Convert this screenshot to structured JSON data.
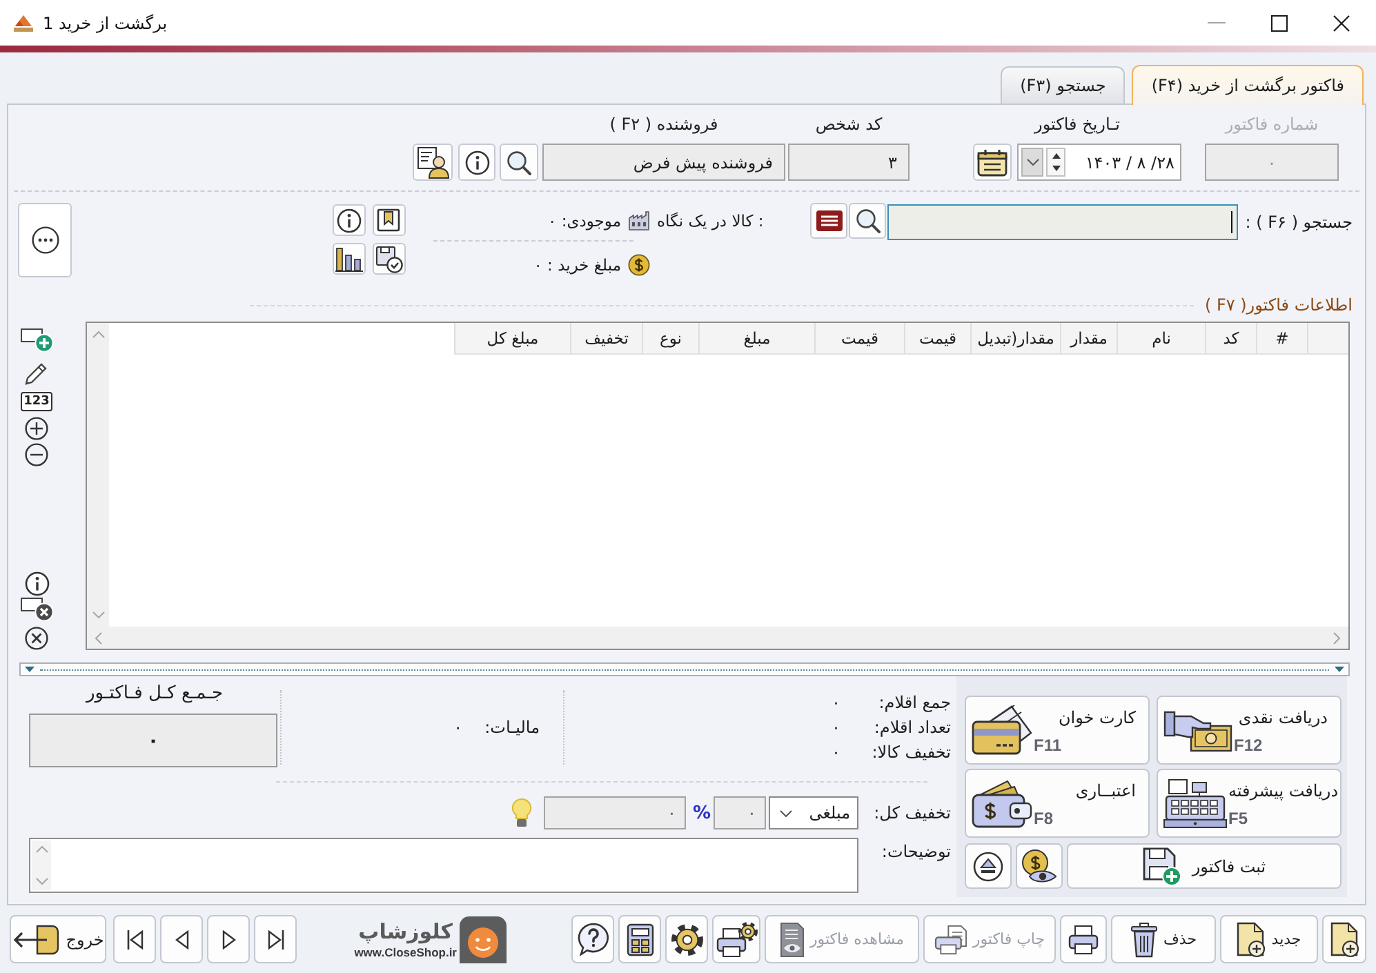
{
  "window": {
    "title": "برگشت از خرید 1"
  },
  "tabs": [
    {
      "label": "فاکتور برگشت از خرید (F۴)",
      "selected": true
    },
    {
      "label": "جستجو (F۳)",
      "selected": false
    }
  ],
  "header": {
    "invoice_number": {
      "label": "شماره فاکتور",
      "value": "۰",
      "disabled": true
    },
    "invoice_date": {
      "label": "تـاریخ فاکتور",
      "value": "۱۴۰۳ / ۸ /۲۸"
    },
    "person_code": {
      "label": "کد شخص",
      "value": "۳"
    },
    "seller": {
      "label": "فروشنده ( F۲ )",
      "value": "فروشنده پیش فرض"
    }
  },
  "product_search": {
    "label": "جستجو ( F۶ ) :",
    "overview_label": ": کالا در یک نگاه",
    "stock": "موجودی: ۰",
    "purchase_amount": "مبلغ خرید : ۰"
  },
  "invoice_items": {
    "title": "اطلاعات فاکتور( F۷ )",
    "columns": [
      "#",
      "کد",
      "نام",
      "مقدار",
      "مقدار(تبدیل",
      "قیمت",
      "قیمت",
      "مبلغ",
      "نوع",
      "تخفیف",
      "مبلغ کل"
    ]
  },
  "grid_tools": {
    "numbering_label": "123"
  },
  "summary": [
    {
      "label": "جمع اقلام:",
      "value": "۰"
    },
    {
      "label": "تعداد اقلام:",
      "value": "۰"
    },
    {
      "label": "تخفیف کالا:",
      "value": "۰"
    }
  ],
  "tax": {
    "label": "مالیـات:",
    "value": "۰"
  },
  "grand_total": {
    "label": "جـمـع کـل فـاکتـور",
    "value": "۰"
  },
  "discount": {
    "label": "تخفیف کل:",
    "mode": "مبلغی",
    "percent_value": "۰",
    "percent_sign": "%",
    "amount_value": "۰"
  },
  "notes": {
    "label": "توضیحات:"
  },
  "payment_buttons": [
    {
      "kind": "cash",
      "label": "دریافت نقدی",
      "shortcut": "F12"
    },
    {
      "kind": "card",
      "label": "کارت خوان",
      "shortcut": "F11"
    },
    {
      "kind": "advanced",
      "label": "دریافت پیشرفته",
      "shortcut": "F5"
    },
    {
      "kind": "credit",
      "label": "اعتبــاری",
      "shortcut": "F8"
    }
  ],
  "save_button": {
    "label": "ثبت فاکتور"
  },
  "toolbar": [
    {
      "kind": "new_doc",
      "disabled": false
    },
    {
      "kind": "new",
      "label": "جدید",
      "disabled": false
    },
    {
      "kind": "delete",
      "label": "حذف",
      "disabled": false
    },
    {
      "kind": "print",
      "disabled": false
    },
    {
      "kind": "print_invoice",
      "label": "چاپ فاکتور",
      "disabled": true
    },
    {
      "kind": "view_invoice",
      "label": "مشاهده فاکتور",
      "disabled": true
    },
    {
      "kind": "print_settings",
      "disabled": false
    },
    {
      "kind": "settings",
      "disabled": false
    },
    {
      "kind": "calculator",
      "disabled": false
    },
    {
      "kind": "help",
      "disabled": false
    }
  ],
  "logo": {
    "name": "کلوزشاپ",
    "url": "www.CloseShop.ir"
  },
  "navigation": [
    {
      "kind": "last"
    },
    {
      "kind": "next"
    },
    {
      "kind": "previous"
    },
    {
      "kind": "first"
    }
  ],
  "exit_button": {
    "label": "خروج"
  }
}
